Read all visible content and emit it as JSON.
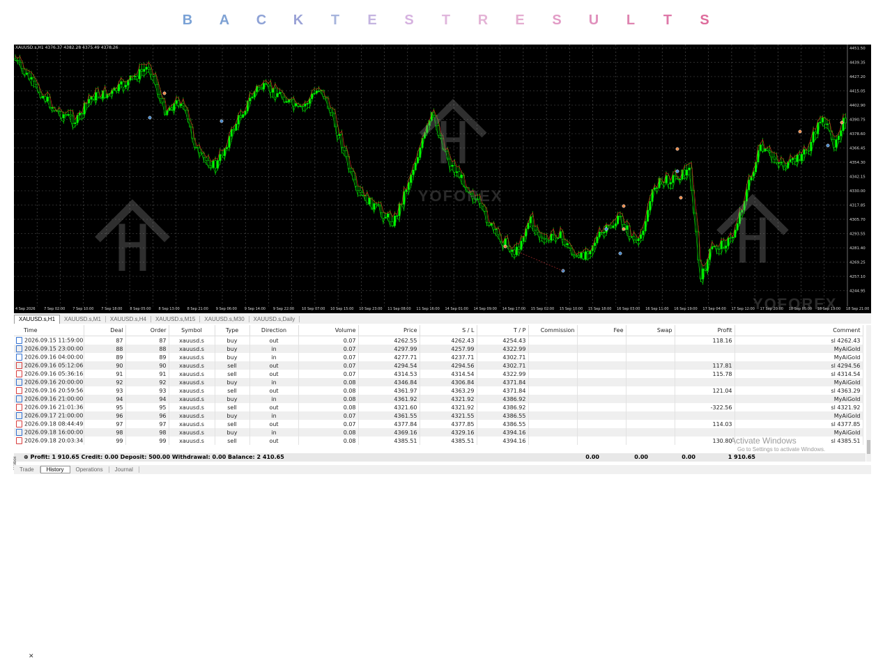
{
  "banner": {
    "letters": [
      "B",
      "A",
      "C",
      "K",
      "T",
      "E",
      "S",
      "T",
      "R",
      "E",
      "S",
      "U",
      "L",
      "T",
      "S"
    ],
    "colors": [
      "#7aa2d6",
      "#7fa2d4",
      "#8ea2d6",
      "#9aa2d6",
      "#a6b4dc",
      "#c4b4e0",
      "#d6b2e0",
      "#e0b6dc",
      "#e4b4d6",
      "#e4acd0",
      "#e29cc6",
      "#e090bc",
      "#de84b0",
      "#de78a8",
      "#de6c9c"
    ]
  },
  "chart": {
    "title": "XAUUSD.s,H1  4376.37 4382.28 4375.49 4378.26",
    "price_labels": [
      "4451.50",
      "4439.35",
      "4427.20",
      "4415.05",
      "4402.90",
      "4390.75",
      "4378.60",
      "4366.45",
      "4354.30",
      "4342.15",
      "4330.00",
      "4317.85",
      "4305.70",
      "4293.55",
      "4281.40",
      "4269.25",
      "4257.10",
      "4244.95"
    ],
    "time_labels": [
      "4 Sep 2026",
      "7 Sep 02:00",
      "7 Sep 10:00",
      "7 Sep 18:00",
      "8 Sep 05:00",
      "8 Sep 13:00",
      "8 Sep 21:00",
      "9 Sep 06:00",
      "9 Sep 14:00",
      "9 Sep 22:00",
      "10 Sep 07:00",
      "10 Sep 15:00",
      "10 Sep 23:00",
      "11 Sep 08:00",
      "11 Sep 16:00",
      "14 Sep 01:00",
      "14 Sep 09:00",
      "14 Sep 17:00",
      "15 Sep 02:00",
      "15 Sep 10:00",
      "15 Sep 18:00",
      "16 Sep 03:00",
      "16 Sep 11:00",
      "16 Sep 19:00",
      "17 Sep 04:00",
      "17 Sep 12:00",
      "17 Sep 20:00",
      "18 Sep 05:00",
      "18 Sep 13:00",
      "18 Sep 21:00"
    ],
    "watermark_text": "YOFOREX",
    "colors": {
      "background": "#000000",
      "bull": "#00ff00",
      "bear": "#000000",
      "wick": "#00dd00",
      "line_red": "#cc2222",
      "grid": "#5a5a5a"
    }
  },
  "chart_tabs": [
    "XAUUSD.s,H1",
    "XAUUSD.s,M1",
    "XAUUSD.s,H4",
    "XAUUSD.s,M15",
    "XAUUSD.s,M30",
    "XAUUSD.s,Daily"
  ],
  "table": {
    "headers": [
      "Time",
      "Deal",
      "Order",
      "Symbol",
      "Type",
      "Direction",
      "Volume",
      "Price",
      "S / L",
      "T / P",
      "Commission",
      "Fee",
      "Swap",
      "Profit",
      "Comment"
    ],
    "rows": [
      {
        "icon": "buy",
        "time": "2026.09.15 11:59:00",
        "deal": "87",
        "order": "87",
        "symbol": "xauusd.s",
        "type": "buy",
        "direction": "out",
        "volume": "0.07",
        "price": "4262.55",
        "sl": "4262.43",
        "tp": "4254.43",
        "commission": "",
        "fee": "",
        "swap": "",
        "profit": "118.16",
        "comment": "sl 4262.43"
      },
      {
        "icon": "buy",
        "time": "2026.09.15 23:00:00",
        "deal": "88",
        "order": "88",
        "symbol": "xauusd.s",
        "type": "buy",
        "direction": "in",
        "volume": "0.07",
        "price": "4297.99",
        "sl": "4257.99",
        "tp": "4322.99",
        "commission": "",
        "fee": "",
        "swap": "",
        "profit": "",
        "comment": "MyAiGold"
      },
      {
        "icon": "buy",
        "time": "2026.09.16 04:00:00",
        "deal": "89",
        "order": "89",
        "symbol": "xauusd.s",
        "type": "buy",
        "direction": "in",
        "volume": "0.07",
        "price": "4277.71",
        "sl": "4237.71",
        "tp": "4302.71",
        "commission": "",
        "fee": "",
        "swap": "",
        "profit": "",
        "comment": "MyAiGold"
      },
      {
        "icon": "sell",
        "time": "2026.09.16 05:12:06",
        "deal": "90",
        "order": "90",
        "symbol": "xauusd.s",
        "type": "sell",
        "direction": "out",
        "volume": "0.07",
        "price": "4294.54",
        "sl": "4294.56",
        "tp": "4302.71",
        "commission": "",
        "fee": "",
        "swap": "",
        "profit": "117.81",
        "comment": "sl 4294.56"
      },
      {
        "icon": "sell",
        "time": "2026.09.16 05:36:16",
        "deal": "91",
        "order": "91",
        "symbol": "xauusd.s",
        "type": "sell",
        "direction": "out",
        "volume": "0.07",
        "price": "4314.53",
        "sl": "4314.54",
        "tp": "4322.99",
        "commission": "",
        "fee": "",
        "swap": "",
        "profit": "115.78",
        "comment": "sl 4314.54"
      },
      {
        "icon": "buy",
        "time": "2026.09.16 20:00:00",
        "deal": "92",
        "order": "92",
        "symbol": "xauusd.s",
        "type": "buy",
        "direction": "in",
        "volume": "0.08",
        "price": "4346.84",
        "sl": "4306.84",
        "tp": "4371.84",
        "commission": "",
        "fee": "",
        "swap": "",
        "profit": "",
        "comment": "MyAiGold"
      },
      {
        "icon": "sell",
        "time": "2026.09.16 20:59:56",
        "deal": "93",
        "order": "93",
        "symbol": "xauusd.s",
        "type": "sell",
        "direction": "out",
        "volume": "0.08",
        "price": "4361.97",
        "sl": "4363.29",
        "tp": "4371.84",
        "commission": "",
        "fee": "",
        "swap": "",
        "profit": "121.04",
        "comment": "sl 4363.29"
      },
      {
        "icon": "buy",
        "time": "2026.09.16 21:00:00",
        "deal": "94",
        "order": "94",
        "symbol": "xauusd.s",
        "type": "buy",
        "direction": "in",
        "volume": "0.08",
        "price": "4361.92",
        "sl": "4321.92",
        "tp": "4386.92",
        "commission": "",
        "fee": "",
        "swap": "",
        "profit": "",
        "comment": "MyAiGold"
      },
      {
        "icon": "sell",
        "time": "2026.09.16 21:01:36",
        "deal": "95",
        "order": "95",
        "symbol": "xauusd.s",
        "type": "sell",
        "direction": "out",
        "volume": "0.08",
        "price": "4321.60",
        "sl": "4321.92",
        "tp": "4386.92",
        "commission": "",
        "fee": "",
        "swap": "",
        "profit": "-322.56",
        "comment": "sl 4321.92"
      },
      {
        "icon": "buy",
        "time": "2026.09.17 21:00:00",
        "deal": "96",
        "order": "96",
        "symbol": "xauusd.s",
        "type": "buy",
        "direction": "in",
        "volume": "0.07",
        "price": "4361.55",
        "sl": "4321.55",
        "tp": "4386.55",
        "commission": "",
        "fee": "",
        "swap": "",
        "profit": "",
        "comment": "MyAiGold"
      },
      {
        "icon": "sell",
        "time": "2026.09.18 08:44:49",
        "deal": "97",
        "order": "97",
        "symbol": "xauusd.s",
        "type": "sell",
        "direction": "out",
        "volume": "0.07",
        "price": "4377.84",
        "sl": "4377.85",
        "tp": "4386.55",
        "commission": "",
        "fee": "",
        "swap": "",
        "profit": "114.03",
        "comment": "sl 4377.85"
      },
      {
        "icon": "buy",
        "time": "2026.09.18 16:00:00",
        "deal": "98",
        "order": "98",
        "symbol": "xauusd.s",
        "type": "buy",
        "direction": "in",
        "volume": "0.08",
        "price": "4369.16",
        "sl": "4329.16",
        "tp": "4394.16",
        "commission": "",
        "fee": "",
        "swap": "",
        "profit": "",
        "comment": "MyAiGold"
      },
      {
        "icon": "sell",
        "time": "2026.09.18 20:03:34",
        "deal": "99",
        "order": "99",
        "symbol": "xauusd.s",
        "type": "sell",
        "direction": "out",
        "volume": "0.08",
        "price": "4385.51",
        "sl": "4385.51",
        "tp": "4394.16",
        "commission": "",
        "fee": "",
        "swap": "",
        "profit": "130.80",
        "comment": "sl 4385.51"
      }
    ]
  },
  "summary": {
    "text": "Profit: 1 910.65  Credit: 0.00  Deposit: 500.00  Withdrawal: 0.00  Balance: 2 410.65",
    "commission": "0.00",
    "fee": "0.00",
    "swap": "0.00",
    "profit": "1 910.65"
  },
  "bottom_tabs": [
    "Trade",
    "History",
    "Operations",
    "Journal"
  ],
  "toolbox_label": "Toolbox",
  "activation": {
    "title": "Activate Windows",
    "subtitle": "Go to Settings to activate Windows."
  }
}
